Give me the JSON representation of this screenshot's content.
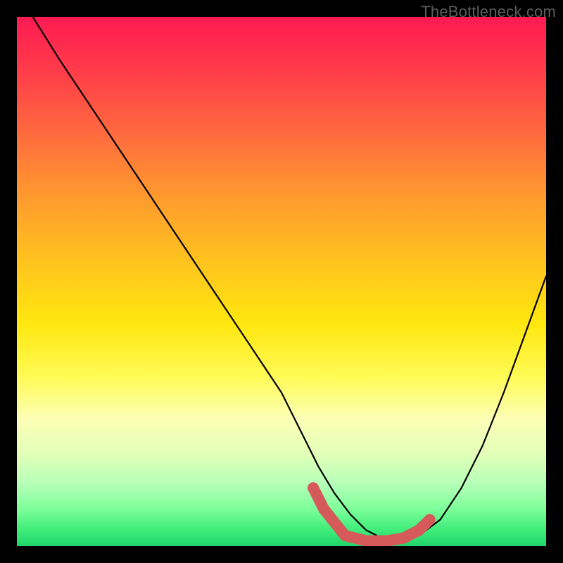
{
  "watermark": "TheBottleneck.com",
  "chart_data": {
    "type": "line",
    "title": "",
    "xlabel": "",
    "ylabel": "",
    "xlim": [
      0,
      100
    ],
    "ylim": [
      0,
      100
    ],
    "series": [
      {
        "name": "bottleneck-curve",
        "x": [
          3,
          8,
          14,
          20,
          26,
          32,
          38,
          44,
          50,
          54,
          57,
          60,
          63,
          66,
          70,
          73,
          76,
          80,
          84,
          88,
          92,
          96,
          100
        ],
        "y": [
          100,
          92,
          83,
          74,
          65,
          56,
          47,
          38,
          29,
          21,
          15,
          10,
          6,
          3,
          1,
          1,
          2,
          5,
          11,
          19,
          29,
          40,
          51
        ]
      }
    ],
    "markers": {
      "name": "highlight-band",
      "color": "#d65a5a",
      "points": [
        {
          "x": 56,
          "y": 11
        },
        {
          "x": 58,
          "y": 7
        },
        {
          "x": 62,
          "y": 2
        },
        {
          "x": 66,
          "y": 1
        },
        {
          "x": 70,
          "y": 1
        },
        {
          "x": 73,
          "y": 1.5
        },
        {
          "x": 76,
          "y": 3
        },
        {
          "x": 78,
          "y": 5
        }
      ]
    }
  }
}
